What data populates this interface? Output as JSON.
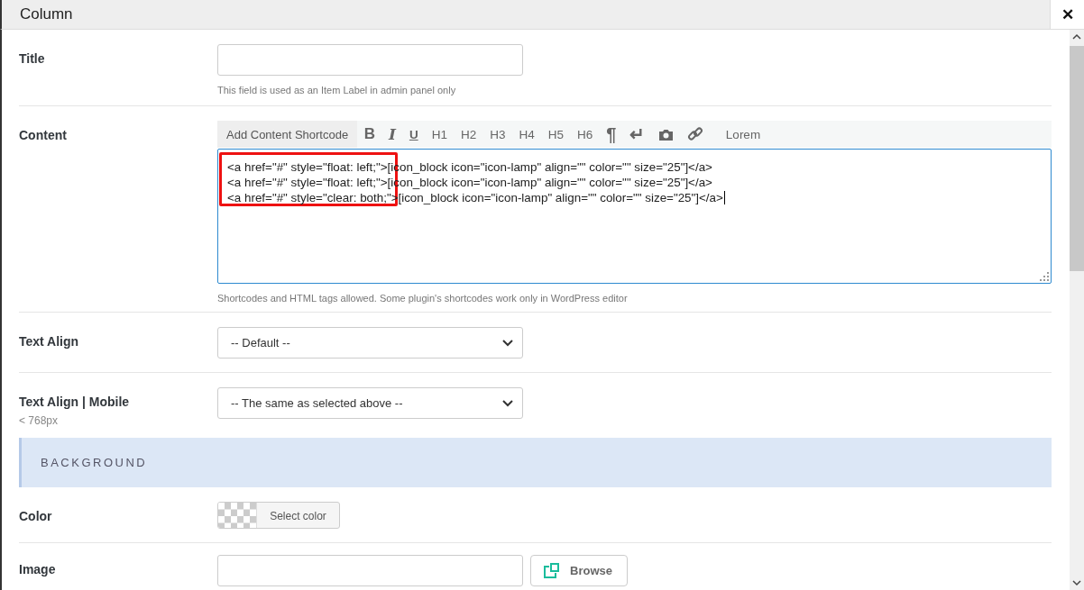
{
  "window": {
    "title": "Column",
    "close": "✕"
  },
  "fields": [
    {
      "kind": "text",
      "label": "Title",
      "help": "This field is used as an Item Label in admin panel only"
    },
    {
      "kind": "editor",
      "label": "Content",
      "shortcode_button": "Add Content Shortcode",
      "toolbar": [
        "B",
        "I",
        "U",
        "H1",
        "H2",
        "H3",
        "H4",
        "H5",
        "H6",
        "¶",
        "↵"
      ],
      "toolbar_end": [
        "Lorem"
      ],
      "lines": [
        "<a href=\"#\" style=\"float: left;\">[icon_block icon=\"icon-lamp\" align=\"\" color=\"\" size=\"25\"]</a>",
        "<a href=\"#\" style=\"float: left;\">[icon_block icon=\"icon-lamp\" align=\"\" color=\"\" size=\"25\"]</a>",
        "<a href=\"#\" style=\"clear: both;\">[icon_block icon=\"icon-lamp\" align=\"\" color=\"\" size=\"25\"]</a>"
      ],
      "help": "Shortcodes and HTML tags allowed. Some plugin's shortcodes work only in WordPress editor"
    },
    {
      "kind": "select",
      "label": "Text Align",
      "value": "-- Default --"
    },
    {
      "kind": "select",
      "label": "Text Align | Mobile",
      "sublabel": "< 768px",
      "value": "-- The same as selected above --"
    },
    {
      "kind": "section",
      "label": "BACKGROUND"
    },
    {
      "kind": "color",
      "label": "Color",
      "button": "Select color"
    },
    {
      "kind": "browse",
      "label": "Image",
      "button": "Browse"
    }
  ]
}
